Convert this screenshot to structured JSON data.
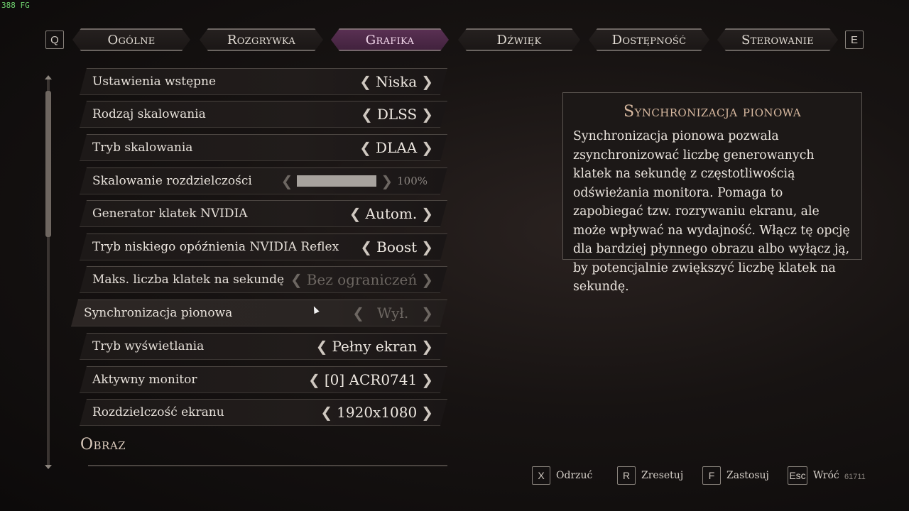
{
  "overlay": {
    "fps": "388 FG"
  },
  "tabs": {
    "prev_key": "Q",
    "next_key": "E",
    "items": [
      {
        "label": "Ogólne",
        "active": false
      },
      {
        "label": "Rozgrywka",
        "active": false
      },
      {
        "label": "Grafika",
        "active": true
      },
      {
        "label": "Dźwięk",
        "active": false
      },
      {
        "label": "Dostępność",
        "active": false
      },
      {
        "label": "Sterowanie",
        "active": false
      }
    ]
  },
  "settings": [
    {
      "label": "Ustawienia wstępne",
      "value": "Niska"
    },
    {
      "label": "Rodzaj skalowania",
      "value": "DLSS"
    },
    {
      "label": "Tryb skalowania",
      "value": "DLAA"
    },
    {
      "label": "Skalowanie rozdzielczości",
      "value": "100%",
      "slider_level_percent": 100
    },
    {
      "label": "Generator klatek NVIDIA",
      "value": "Autom."
    },
    {
      "label": "Tryb niskiego opóźnienia NVIDIA Reflex",
      "value": "Boost"
    },
    {
      "label": "Maks. liczba klatek na sekundę",
      "value": "Bez ograniczeń",
      "disabled": true
    },
    {
      "label": "Synchronizacja pionowa",
      "value": "Wył.",
      "disabled": true,
      "selected": true
    },
    {
      "label": "Tryb wyświetlania",
      "value": "Pełny ekran"
    },
    {
      "label": "Aktywny monitor",
      "value": "[0] ACR0741"
    },
    {
      "label": "Rozdzielczość ekranu",
      "value": "1920x1080"
    }
  ],
  "section_next": "Obraz",
  "info": {
    "title": "Synchronizacja pionowa",
    "body": "Synchronizacja pionowa pozwala zsynchronizować liczbę generowanych klatek na sekundę z częstotliwością odświeżania monitora. Pomaga to zapobiegać tzw. rozrywaniu ekranu, ale może wpływać na wydajność. Włącz tę opcję dla bardziej płynnego obrazu albo wyłącz ją, by potencjalnie zwiększyć liczbę klatek na sekundę."
  },
  "hints": [
    {
      "key": "X",
      "label": "Odrzuć"
    },
    {
      "key": "R",
      "label": "Zresetuj"
    },
    {
      "key": "F",
      "label": "Zastosuj"
    },
    {
      "key": "Esc",
      "label": "Wróć"
    }
  ],
  "build": "61711",
  "colors": {
    "active_tab": "#5b3154",
    "info_title": "#d8b9a0",
    "fps_text": "#6fd36f"
  }
}
